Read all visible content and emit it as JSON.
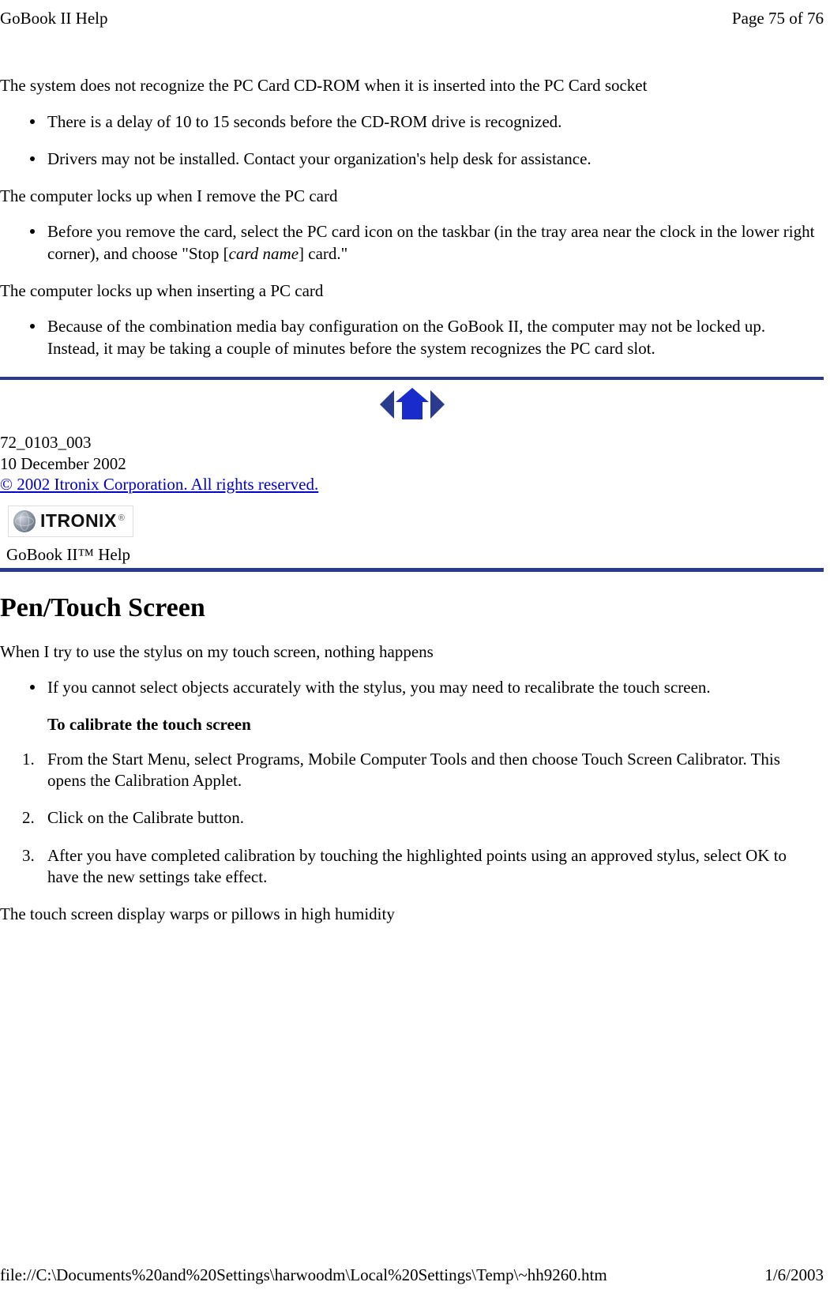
{
  "header": {
    "left": "GoBook II Help",
    "right": "Page 75 of 76"
  },
  "s1": {
    "p1": "The system does not recognize the PC Card CD-ROM when it is inserted into the PC Card socket",
    "b1": "There is a delay of 10 to 15 seconds before the CD-ROM drive is recognized.",
    "b2": "Drivers may not be installed. Contact your organization's help desk for assistance.",
    "p2": "The computer locks up when I remove the PC card",
    "b3a": "Before you remove the card, select the PC card icon on the taskbar (in the tray area near the clock in the lower right corner), and choose \"Stop [",
    "b3_italic": "card name",
    "b3b": "] card.\"",
    "p3": "The computer locks up when inserting a PC card",
    "b4": "Because of the combination media bay configuration on the GoBook II, the computer may not be locked up.  Instead, it may be taking a couple of minutes before the system recognizes the PC card slot."
  },
  "meta": {
    "doc_id": "72_0103_003",
    "date": "10 December 2002",
    "copyright": "© 2002 Itronix Corporation.  All rights reserved."
  },
  "logo": {
    "text": "ITRONIX",
    "reg": "®"
  },
  "help_title": "GoBook II™ Help",
  "s2": {
    "heading": "Pen/Touch Screen",
    "p1": "When I try to use the stylus on my touch screen, nothing happens",
    "b1": "If you cannot select objects accurately with the stylus, you may need to recalibrate the touch screen.",
    "sub_bold": "To calibrate the touch screen",
    "n1": "From the Start Menu, select Programs, Mobile Computer Tools and then choose Touch Screen Calibrator.  This opens the Calibration Applet.",
    "n2": "Click on the Calibrate button.",
    "n3": "After you have completed calibration by touching the highlighted points using an approved stylus, select OK to have the new settings take effect.",
    "p2": "The touch screen display warps or pillows in high humidity"
  },
  "footer": {
    "left": "file://C:\\Documents%20and%20Settings\\harwoodm\\Local%20Settings\\Temp\\~hh9260.htm",
    "right": "1/6/2003"
  }
}
